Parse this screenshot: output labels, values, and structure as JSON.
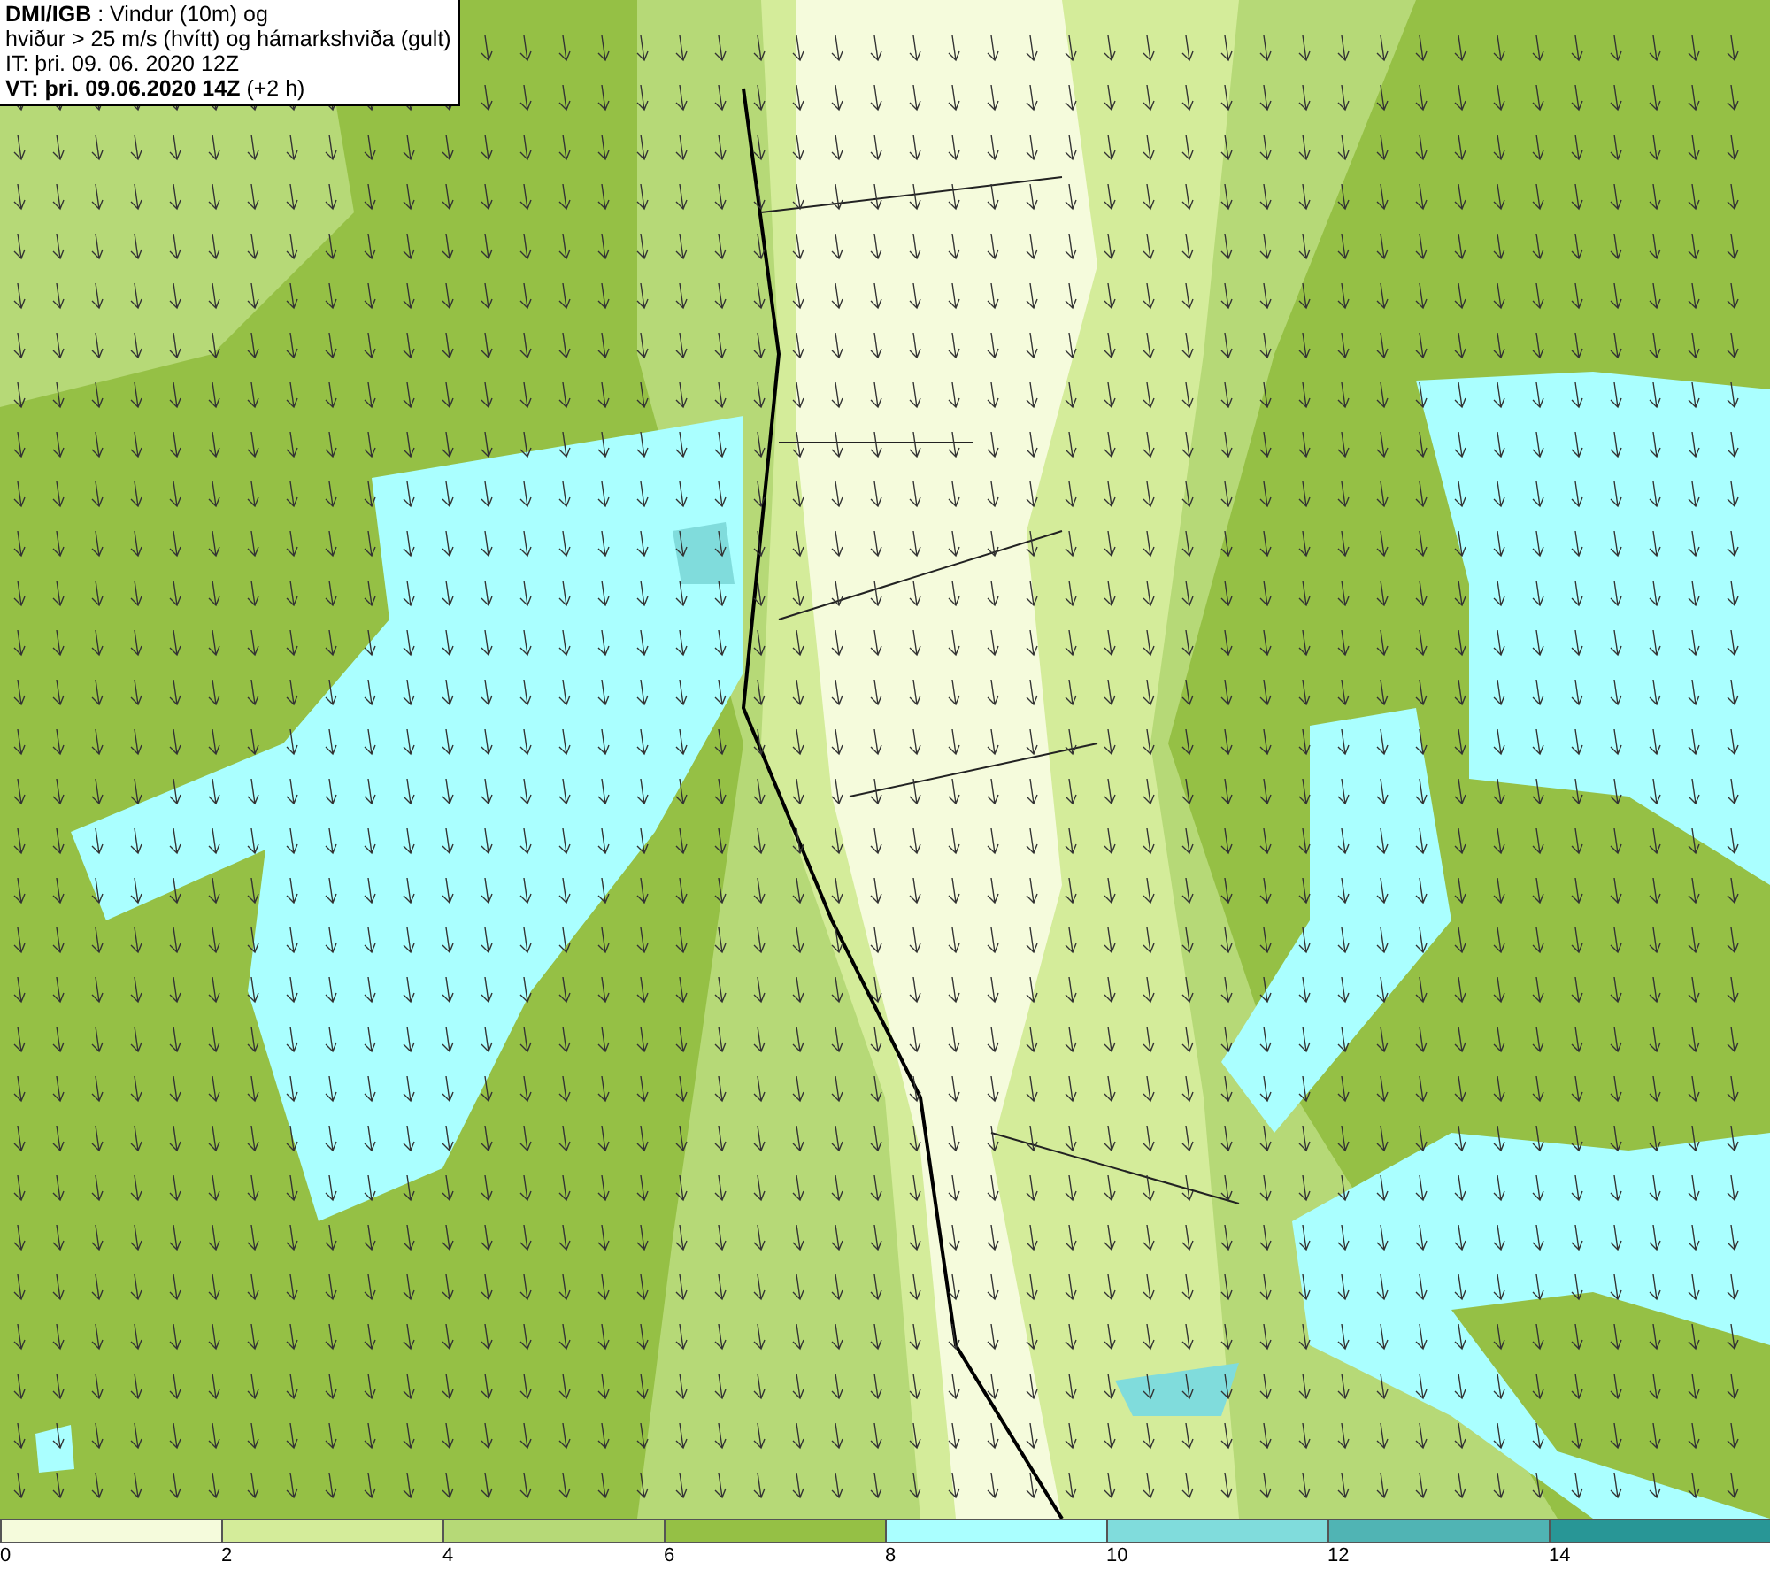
{
  "info_box": {
    "lines": [
      "**DMI/IGB** : Vindur (10m) og",
      "hviður > 25 m/s (hvítt) og hámarkshviða (gult)",
      "IT: þri. 09. 06. 2020 12Z",
      "**VT: þri. 09.06.2020 14Z** (+2 h)"
    ]
  },
  "legend": [
    {
      "label": "0",
      "color": "#f5fbdc"
    },
    {
      "label": "2",
      "color": "#d4ec9a"
    },
    {
      "label": "4",
      "color": "#b6d977"
    },
    {
      "label": "6",
      "color": "#95c045"
    },
    {
      "label": "8",
      "color": "#aaffff"
    },
    {
      "label": "10",
      "color": "#80dcdc"
    },
    {
      "label": "12",
      "color": "#50b4b4"
    },
    {
      "label": "14",
      "color": "#289696"
    }
  ]
}
